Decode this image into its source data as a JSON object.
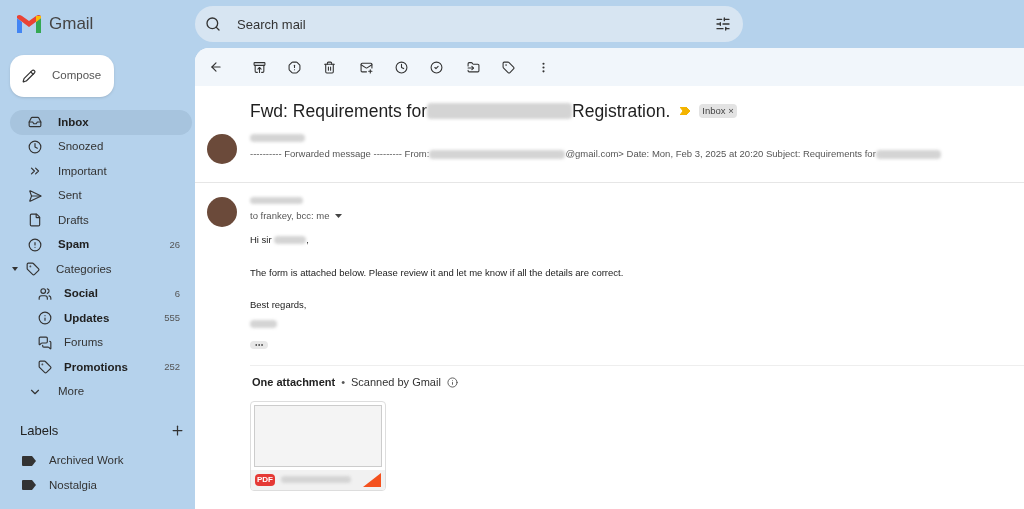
{
  "app": {
    "name": "Gmail"
  },
  "search": {
    "placeholder": "Search mail"
  },
  "compose": {
    "label": "Compose"
  },
  "sidebar": {
    "items": [
      {
        "label": "Inbox",
        "selected": true,
        "unread": true
      },
      {
        "label": "Snoozed",
        "selected": false,
        "unread": false
      },
      {
        "label": "Important",
        "selected": false,
        "unread": false
      },
      {
        "label": "Sent",
        "selected": false,
        "unread": false
      },
      {
        "label": "Drafts",
        "selected": false,
        "unread": false
      },
      {
        "label": "Spam",
        "selected": false,
        "unread": true,
        "count": "26"
      },
      {
        "label": "Categories",
        "selected": false,
        "unread": false,
        "expanded": true,
        "children": [
          {
            "label": "Social",
            "selected": false,
            "unread": true,
            "count": "6"
          },
          {
            "label": "Updates",
            "selected": false,
            "unread": true,
            "count": "555"
          },
          {
            "label": "Forums",
            "selected": false,
            "unread": false
          },
          {
            "label": "Promotions",
            "selected": false,
            "unread": true,
            "count": "252"
          }
        ]
      },
      {
        "label": "More",
        "selected": false,
        "unread": false
      }
    ]
  },
  "labels": {
    "title": "Labels",
    "items": [
      {
        "label": "Archived Work"
      },
      {
        "label": "Nostalgia"
      }
    ]
  },
  "thread": {
    "subject_start": "Fwd: Requirements for",
    "subject_end": "Registration.",
    "important": true,
    "tag": {
      "label": "Inbox",
      "remove": "×"
    },
    "collapsed_message": {
      "snippet_start": "---------- Forwarded message --------- From:",
      "snippet_middle": "@gmail.com> Date: Mon, Feb 3, 2025 at 20:20 Subject: Requirements for"
    },
    "open_message": {
      "recipients": "to frankey, bcc: me",
      "greeting": "Hi sir",
      "greeting_end": ",",
      "body": "The form is attached below. Please review it and let me know if all the details are correct.",
      "closing": "Best regards,"
    },
    "attachments": {
      "title": "One attachment",
      "separator": "•",
      "scan_note": "Scanned by Gmail",
      "files": [
        {
          "type": "PDF"
        }
      ]
    }
  }
}
